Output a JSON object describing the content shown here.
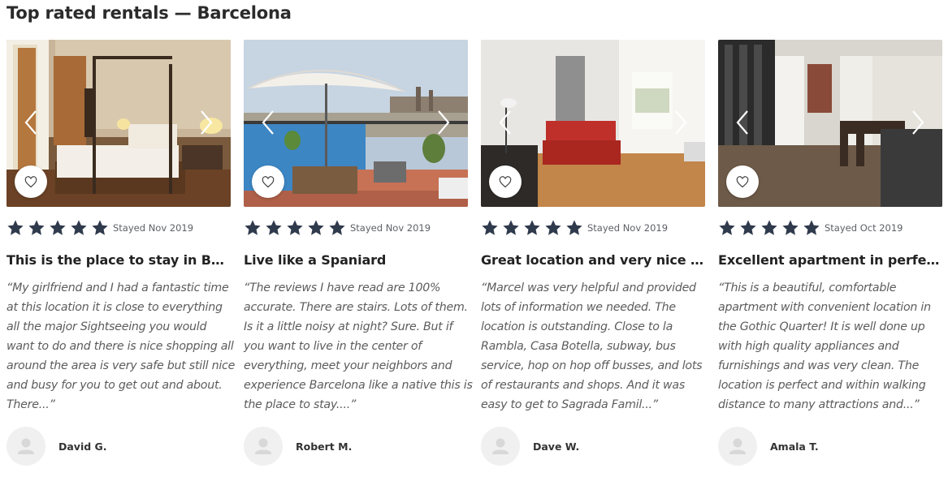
{
  "page": {
    "title": "Top rated rentals — Barcelona"
  },
  "colors": {
    "star": "#2f3a4c",
    "avatar_bg": "#f0f0f0",
    "avatar_icon": "#d8d8d8"
  },
  "icons": {
    "rating": "star-icon",
    "favorite": "heart-outline-icon",
    "prev": "chevron-left-icon",
    "next": "chevron-right-icon",
    "avatar": "user-silhouette-icon"
  },
  "reviews": [
    {
      "image": "bedroom with four-poster bed",
      "stars": 5,
      "stayed": "Stayed Nov 2019",
      "title": "This is the place to stay in Barce...",
      "text": "“My girlfriend and I had a fantastic time at this location it is close to everything all the major Sightseeing you would want to do and there is nice shopping all around the area is very safe but still nice and busy for you to get out and about. There...”",
      "author": "David G."
    },
    {
      "image": "rooftop terrace with parasol",
      "stars": 5,
      "stayed": "Stayed Nov 2019",
      "title": "Live like a Spaniard",
      "text": "“The reviews I have read are 100% accurate. There are stairs. Lots of them. Is it a little noisy at night? Sure. But if you want to live in the center of everything, meet your neighbors and experience Barcelona like a native this is the place to stay....”",
      "author": "Robert M."
    },
    {
      "image": "living room with red sofa",
      "stars": 5,
      "stayed": "Stayed Nov 2019",
      "title": "Great location and very nice apa...",
      "text": "“Marcel was very helpful and provided lots of information we needed. The location is outstanding. Close to la Rambla, Casa Botella, subway, bus service, hop on hop off busses, and lots of restaurants and shops. And it was easy to get to Sagrada Famil...”",
      "author": "Dave W."
    },
    {
      "image": "dining room with long table",
      "stars": 5,
      "stayed": "Stayed Oct 2019",
      "title": "Excellent apartment in perfect l...",
      "text": "“This is a beautiful, comfortable apartment with convenient location in the Gothic Quarter! It is well done up with high quality appliances and furnishings and was very clean. The location is perfect and within walking distance to many attractions and...”",
      "author": "Amala T."
    }
  ]
}
